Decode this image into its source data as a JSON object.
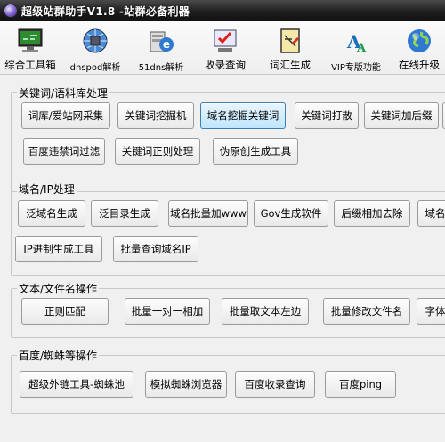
{
  "window": {
    "title": "超级站群助手V1.8  -站群必备利器"
  },
  "toolbar": {
    "items": [
      {
        "label": "综合工具箱",
        "icon": "monitor-icon"
      },
      {
        "label": "dnspod解析",
        "icon": "network-icon"
      },
      {
        "label": "51dns解析",
        "icon": "ie-server-icon"
      },
      {
        "label": "收录查询",
        "icon": "checkmark-screen-icon"
      },
      {
        "label": "词汇生成",
        "icon": "notepad-icon"
      },
      {
        "label": "VIP专版功能",
        "icon": "aa-icon"
      },
      {
        "label": "在线升级",
        "icon": "globe-icon"
      }
    ]
  },
  "groups": {
    "keywords": {
      "title": "关键词/语料库处理",
      "buttons": [
        "词库/爱站网采集",
        "关键词挖掘机",
        "域名挖掘关键词",
        "关键词打散",
        "关键词加后缀",
        "百度违禁词过滤",
        "关键词正则处理",
        "伪原创生成工具"
      ]
    },
    "domain": {
      "title": "域名/IP处理",
      "buttons": [
        "泛域名生成",
        "泛目录生成",
        "域名批量加www",
        "Gov生成软件",
        "后缀相加去除",
        "域名",
        "IP进制生成工具",
        "批量查询域名IP"
      ]
    },
    "text": {
      "title": "文本/文件名操作",
      "buttons": [
        "正则匹配",
        "批量一对一相加",
        "批量取文本左边",
        "批量修改文件名",
        "字体"
      ]
    },
    "baidu": {
      "title": "百度/蜘蛛等操作",
      "buttons": [
        "超级外链工具-蜘蛛池",
        "模拟蜘蛛浏览器",
        "百度收录查询",
        "百度ping"
      ]
    }
  }
}
